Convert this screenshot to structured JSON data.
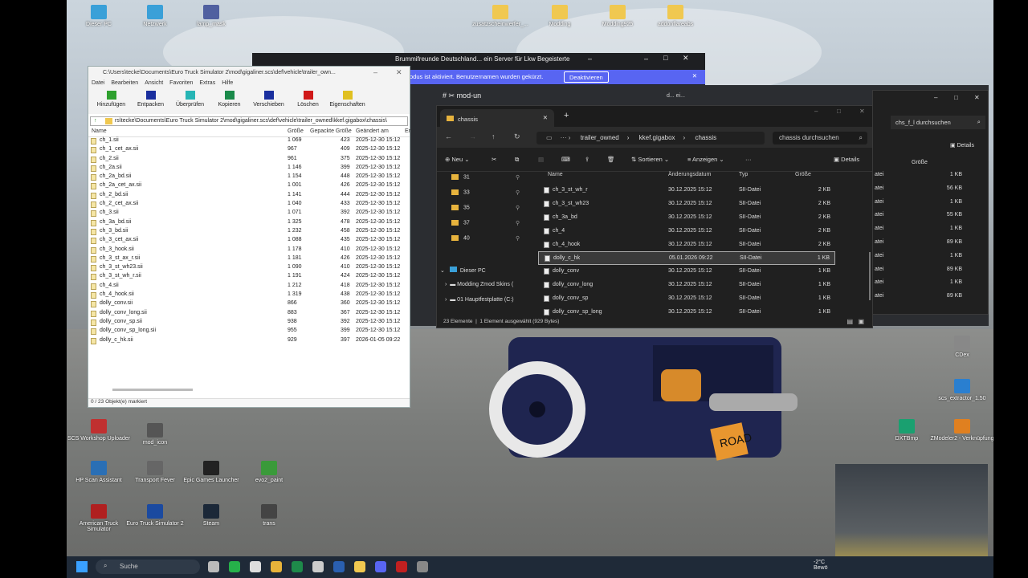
{
  "desktop_icons": [
    {
      "label": "Dieser PC",
      "icon": "pc-icon",
      "color": "#3aa0d8"
    },
    {
      "label": "Netzwerk",
      "icon": "network-icon",
      "color": "#3aa0d8"
    },
    {
      "label": "lamp_mask",
      "icon": "app-icon",
      "color": "#5060a0"
    },
    {
      "label": "zusatzscheinwerfer_...",
      "icon": "folder-icon",
      "color": "#f0c850"
    },
    {
      "label": "Modding",
      "icon": "folder-icon",
      "color": "#f0c850"
    },
    {
      "label": "Modding925",
      "icon": "folder-icon",
      "color": "#f0c850"
    },
    {
      "label": "addonflareabs",
      "icon": "folder-icon",
      "color": "#f0c850"
    },
    {
      "label": "SCS Workshop Uploader",
      "icon": "scs-icon",
      "color": "#c03030"
    },
    {
      "label": "mod_icon",
      "icon": "image-icon",
      "color": "#555"
    },
    {
      "label": "HP Scan Assistant",
      "icon": "scanner-icon",
      "color": "#2a6fb5"
    },
    {
      "label": "Transport Fever",
      "icon": "game-icon",
      "color": "#666"
    },
    {
      "label": "Epic Games Launcher",
      "icon": "epic-icon",
      "color": "#222"
    },
    {
      "label": "evo2_paint",
      "icon": "image-icon",
      "color": "#3a9a3a"
    },
    {
      "label": "American Truck Simulator",
      "icon": "truck-icon",
      "color": "#b02020"
    },
    {
      "label": "Euro Truck Simulator 2",
      "icon": "truck-icon",
      "color": "#1b4aa0"
    },
    {
      "label": "Steam",
      "icon": "steam-icon",
      "color": "#1b2838"
    },
    {
      "label": "trans",
      "icon": "file-icon",
      "color": "#444"
    },
    {
      "label": "DXTBmp",
      "icon": "app-icon",
      "color": "#1aa070"
    },
    {
      "label": "ZModeler2 - Verknüpfung",
      "icon": "zmod-icon",
      "color": "#e08020"
    },
    {
      "label": "scs_extractor_1.50",
      "icon": "app-icon",
      "color": "#2a7fd0"
    },
    {
      "label": "CDex",
      "icon": "cd-icon",
      "color": "#888"
    }
  ],
  "sevenzip": {
    "title": "C:\\Users\\tecke\\Documents\\Euro Truck Simulator 2\\mod\\gigaliner.scs\\def\\vehicle\\trailer_own...",
    "menu": [
      "Datei",
      "Bearbeiten",
      "Ansicht",
      "Favoriten",
      "Extras",
      "Hilfe"
    ],
    "tools": [
      {
        "label": "Hinzufügen",
        "color": "#2ea02e",
        "icon": "plus-icon"
      },
      {
        "label": "Entpacken",
        "color": "#1a2f9e",
        "icon": "minus-icon"
      },
      {
        "label": "Überprüfen",
        "color": "#26b5b5",
        "icon": "check-icon"
      },
      {
        "label": "Kopieren",
        "color": "#1a8a4a",
        "icon": "arrow-right-icon"
      },
      {
        "label": "Verschieben",
        "color": "#1a2f9e",
        "icon": "arrow-right-icon"
      },
      {
        "label": "Löschen",
        "color": "#d01818",
        "icon": "close-icon"
      },
      {
        "label": "Eigenschaften",
        "color": "#e0c020",
        "icon": "info-icon"
      }
    ],
    "address": "rs\\tecke\\Documents\\Euro Truck Simulator 2\\mod\\gigaliner.scs\\def\\vehicle\\trailer_owned\\kkef.gigabox\\chassis\\",
    "columns": [
      "Name",
      "Größe",
      "Gepackte Größe",
      "Geändert am",
      "Er"
    ],
    "rows": [
      [
        "ch_1.sii",
        "1 069",
        "423",
        "2025-12-30 15:12"
      ],
      [
        "ch_1_cet_ax.sii",
        "967",
        "409",
        "2025-12-30 15:12"
      ],
      [
        "ch_2.sii",
        "961",
        "375",
        "2025-12-30 15:12"
      ],
      [
        "ch_2a.sii",
        "1 146",
        "399",
        "2025-12-30 15:12"
      ],
      [
        "ch_2a_bd.sii",
        "1 154",
        "448",
        "2025-12-30 15:12"
      ],
      [
        "ch_2a_cet_ax.sii",
        "1 001",
        "426",
        "2025-12-30 15:12"
      ],
      [
        "ch_2_bd.sii",
        "1 141",
        "444",
        "2025-12-30 15:12"
      ],
      [
        "ch_2_cet_ax.sii",
        "1 040",
        "433",
        "2025-12-30 15:12"
      ],
      [
        "ch_3.sii",
        "1 071",
        "392",
        "2025-12-30 15:12"
      ],
      [
        "ch_3a_bd.sii",
        "1 325",
        "478",
        "2025-12-30 15:12"
      ],
      [
        "ch_3_bd.sii",
        "1 232",
        "458",
        "2025-12-30 15:12"
      ],
      [
        "ch_3_cet_ax.sii",
        "1 088",
        "435",
        "2025-12-30 15:12"
      ],
      [
        "ch_3_hook.sii",
        "1 178",
        "410",
        "2025-12-30 15:12"
      ],
      [
        "ch_3_st_ax_r.sii",
        "1 181",
        "426",
        "2025-12-30 15:12"
      ],
      [
        "ch_3_st_wh23.sii",
        "1 090",
        "410",
        "2025-12-30 15:12"
      ],
      [
        "ch_3_st_wh_r.sii",
        "1 191",
        "424",
        "2025-12-30 15:12"
      ],
      [
        "ch_4.sii",
        "1 212",
        "418",
        "2025-12-30 15:12"
      ],
      [
        "ch_4_hook.sii",
        "1 319",
        "438",
        "2025-12-30 15:12"
      ],
      [
        "dolly_conv.sii",
        "866",
        "360",
        "2025-12-30 15:12"
      ],
      [
        "dolly_conv_long.sii",
        "883",
        "367",
        "2025-12-30 15:12"
      ],
      [
        "dolly_conv_sp.sii",
        "938",
        "392",
        "2025-12-30 15:12"
      ],
      [
        "dolly_conv_sp_long.sii",
        "955",
        "399",
        "2025-12-30 15:12"
      ],
      [
        "dolly_c_hk.sii",
        "929",
        "397",
        "2026-01-05 09:22"
      ]
    ],
    "status": "0 / 23 Objekt(e) markiert"
  },
  "discord": {
    "title": "Brummifreunde Deutschland... ein Server für Lkw Begeisterte",
    "notice": "odus ist aktiviert. Benutzernamen wurden gekürzt.",
    "button": "Deaktivieren",
    "channel": "mod-un",
    "search": "d... ei..."
  },
  "explorer": {
    "tab": "chassis",
    "breadcrumb": [
      "trailer_owned",
      "kkef.gigabox",
      "chassis"
    ],
    "search_placeholder": "chassis durchsuchen",
    "toolbar": {
      "new": "Neu",
      "sort": "Sortieren",
      "view": "Anzeigen",
      "details": "Details"
    },
    "nav_folders": [
      "31",
      "33",
      "35",
      "37",
      "40"
    ],
    "nav_pc": "Dieser PC",
    "nav_drives": [
      "Modding Zmod Skins (",
      "01 Hauptfestplatte (C:)"
    ],
    "columns": [
      "Name",
      "Änderungsdatum",
      "Typ",
      "Größe"
    ],
    "rows": [
      {
        "name": "ch_3_st_wh_r",
        "date": "30.12.2025 15:12",
        "type": "SII-Datei",
        "size": "2 KB",
        "selected": false
      },
      {
        "name": "ch_3_st_wh23",
        "date": "30.12.2025 15:12",
        "type": "SII-Datei",
        "size": "2 KB",
        "selected": false
      },
      {
        "name": "ch_3a_bd",
        "date": "30.12.2025 15:12",
        "type": "SII-Datei",
        "size": "2 KB",
        "selected": false
      },
      {
        "name": "ch_4",
        "date": "30.12.2025 15:12",
        "type": "SII-Datei",
        "size": "2 KB",
        "selected": false
      },
      {
        "name": "ch_4_hook",
        "date": "30.12.2025 15:12",
        "type": "SII-Datei",
        "size": "2 KB",
        "selected": false
      },
      {
        "name": "dolly_c_hk",
        "date": "05.01.2026 09:22",
        "type": "SII-Datei",
        "size": "1 KB",
        "selected": true
      },
      {
        "name": "dolly_conv",
        "date": "30.12.2025 15:12",
        "type": "SII-Datei",
        "size": "1 KB",
        "selected": false
      },
      {
        "name": "dolly_conv_long",
        "date": "30.12.2025 15:12",
        "type": "SII-Datei",
        "size": "1 KB",
        "selected": false
      },
      {
        "name": "dolly_conv_sp",
        "date": "30.12.2025 15:12",
        "type": "SII-Datei",
        "size": "1 KB",
        "selected": false
      },
      {
        "name": "dolly_conv_sp_long",
        "date": "30.12.2025 15:12",
        "type": "SII-Datei",
        "size": "1 KB",
        "selected": false
      }
    ],
    "status_count": "23 Elemente",
    "status_sel": "1 Element ausgewählt (929 Bytes)"
  },
  "explorer2": {
    "search": "chs_f_l durchsuchen",
    "details": "Details",
    "col_size": "Größe",
    "rows": [
      {
        "type": "atei",
        "size": "1 KB"
      },
      {
        "type": "atei",
        "size": "56 KB"
      },
      {
        "type": "atei",
        "size": "1 KB"
      },
      {
        "type": "atei",
        "size": "55 KB"
      },
      {
        "type": "atei",
        "size": "1 KB"
      },
      {
        "type": "atei",
        "size": "89 KB"
      },
      {
        "type": "atei",
        "size": "1 KB"
      },
      {
        "type": "atei",
        "size": "89 KB"
      },
      {
        "type": "atei",
        "size": "1 KB"
      },
      {
        "type": "atei",
        "size": "89 KB"
      }
    ]
  },
  "taskbar": {
    "search": "Suche",
    "weather": "-2°C",
    "weather_sub": "Bewö",
    "accent": "#1f2a38"
  },
  "road_sign": "ROAD"
}
